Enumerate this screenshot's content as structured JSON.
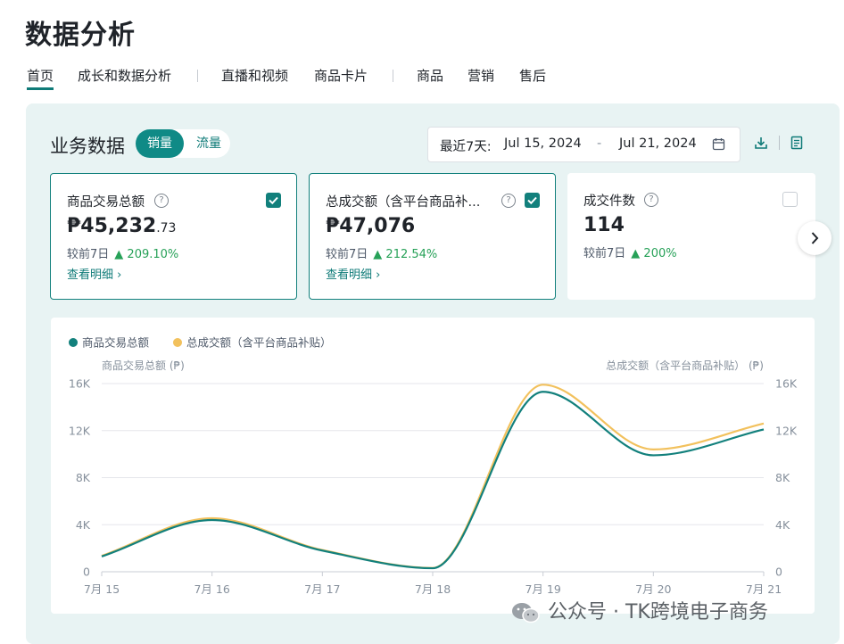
{
  "page": {
    "title": "数据分析"
  },
  "nav": {
    "tabs": [
      {
        "label": "首页",
        "active": true
      },
      {
        "label": "成长和数据分析"
      },
      {
        "label": "直播和视频"
      },
      {
        "label": "商品卡片"
      },
      {
        "label": "商品"
      },
      {
        "label": "营销"
      },
      {
        "label": "售后"
      }
    ]
  },
  "section": {
    "title": "业务数据",
    "toggle": {
      "selected": "销量",
      "other": "流量"
    },
    "date_range": {
      "prefix": "最近7天:",
      "start": "Jul 15, 2024",
      "dash": "-",
      "end": "Jul 21, 2024"
    }
  },
  "metrics": [
    {
      "label": "商品交易总额",
      "value_main": "₱45,232",
      "value_decimal": ".73",
      "compare_label": "较前7日",
      "change": "209.10%",
      "link": "查看明细 ›",
      "checked": true
    },
    {
      "label": "总成交额（含平台商品补...",
      "value_main": "₱47,076",
      "value_decimal": "",
      "compare_label": "较前7日",
      "change": "212.54%",
      "link": "查看明细 ›",
      "checked": true
    },
    {
      "label": "成交件数",
      "value_main": "114",
      "value_decimal": "",
      "compare_label": "较前7日",
      "change": "200%",
      "link": "",
      "checked": false
    }
  ],
  "colors": {
    "accent": "#0f7b78",
    "series1": "#12807c",
    "series2": "#f2c15d",
    "up": "#27a158"
  },
  "chart_data": {
    "type": "line",
    "x": [
      "7月 15",
      "7月 16",
      "7月 17",
      "7月 18",
      "7月 19",
      "7月 20",
      "7月 21"
    ],
    "series": [
      {
        "name": "商品交易总额",
        "values": [
          1300,
          4400,
          1800,
          300,
          15300,
          9900,
          12100
        ]
      },
      {
        "name": "总成交额（含平台商品补贴）",
        "values": [
          1350,
          4550,
          1850,
          320,
          15900,
          10400,
          12600
        ]
      }
    ],
    "ylabel_left": "商品交易总额 (₱)",
    "ylabel_right": "总成交额（含平台商品补贴） (₱)",
    "yticks": [
      "0",
      "4K",
      "8K",
      "12K",
      "16K"
    ],
    "ylim": [
      0,
      16000
    ],
    "legend": "top-left",
    "grid": true
  },
  "watermark": "公众号 · TK跨境电子商务"
}
